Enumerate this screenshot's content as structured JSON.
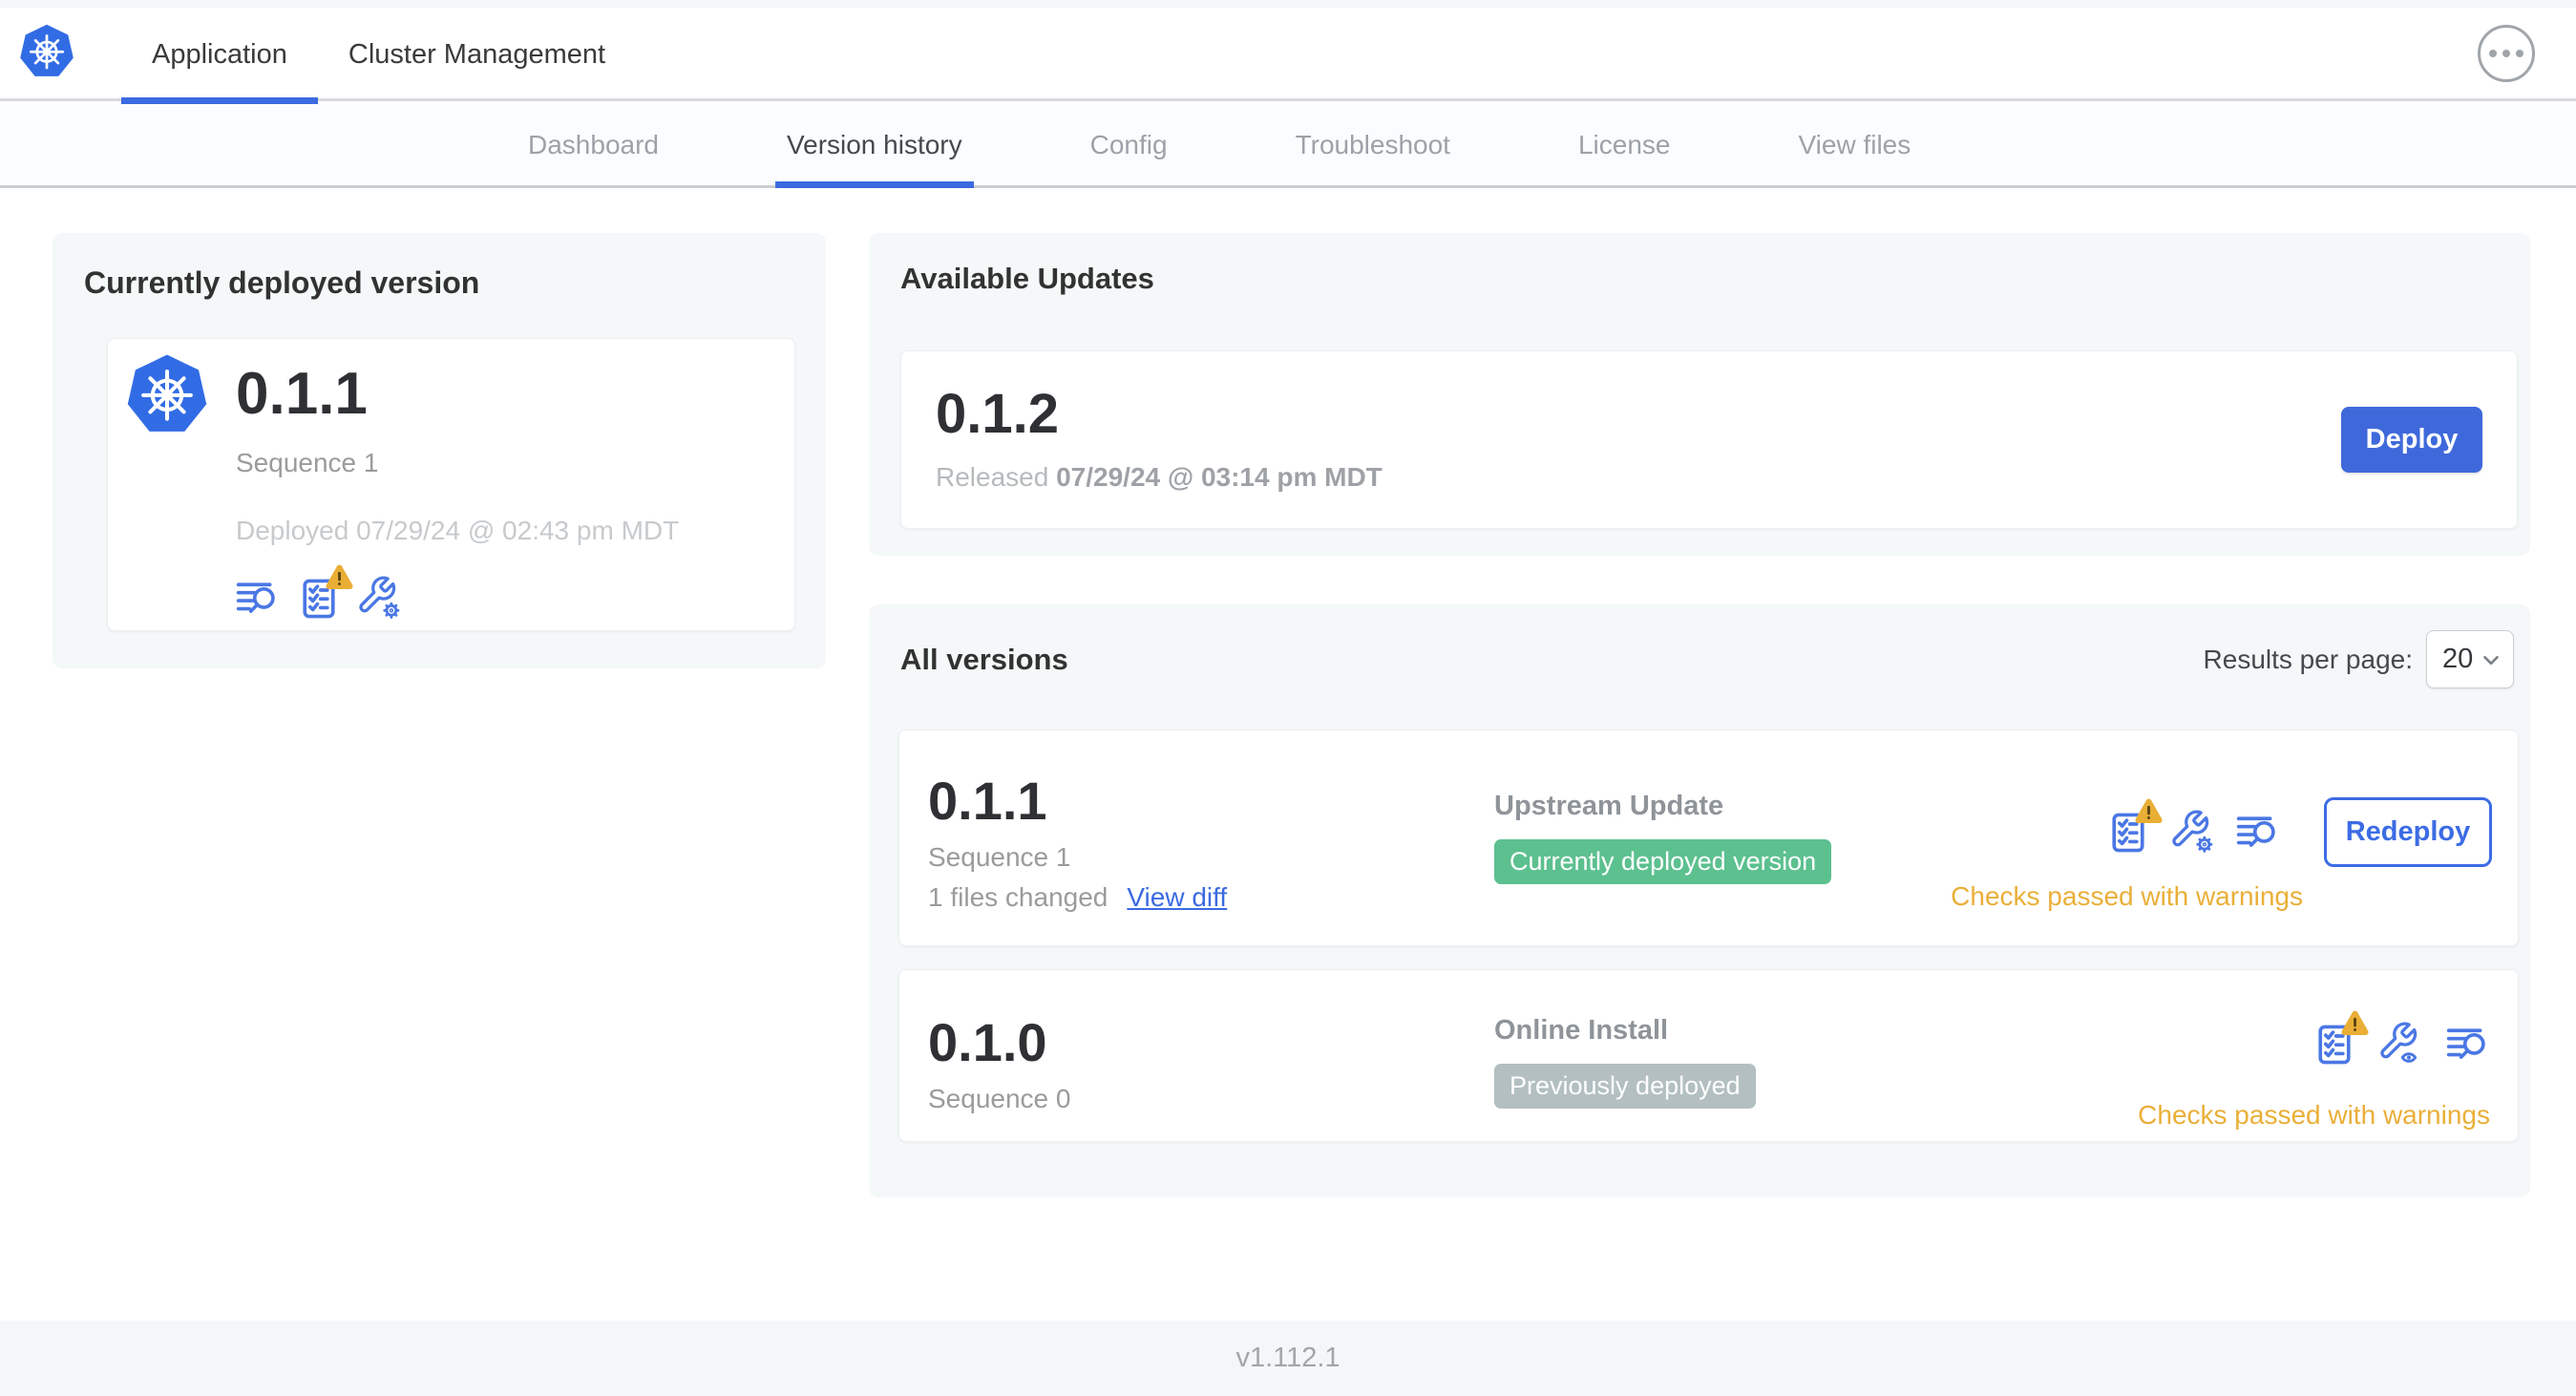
{
  "header": {
    "logo_icon": "kubernetes-logo",
    "tabs": [
      {
        "label": "Application",
        "active": true
      },
      {
        "label": "Cluster Management",
        "active": false
      }
    ],
    "more_icon": "ellipsis-more"
  },
  "nav": {
    "tabs": [
      {
        "label": "Dashboard",
        "active": false
      },
      {
        "label": "Version history",
        "active": true
      },
      {
        "label": "Config",
        "active": false
      },
      {
        "label": "Troubleshoot",
        "active": false
      },
      {
        "label": "License",
        "active": false
      },
      {
        "label": "View files",
        "active": false
      }
    ]
  },
  "current": {
    "title": "Currently deployed version",
    "version": "0.1.1",
    "sequence": "Sequence 1",
    "deployed": "Deployed 07/29/24 @ 02:43 pm MDT",
    "icons": [
      "deploy-logs",
      "preflight-checks-warning",
      "edit-config"
    ]
  },
  "updates": {
    "title": "Available Updates",
    "version": "0.1.2",
    "released_prefix": "Released",
    "released_date": "07/29/24 @ 03:14 pm MDT",
    "deploy_label": "Deploy"
  },
  "all_versions": {
    "title": "All versions",
    "results_label": "Results per page:",
    "results_value": "20",
    "rows": [
      {
        "version": "0.1.1",
        "sequence": "Sequence 1",
        "files_changed": "1 files changed",
        "view_diff": "View diff",
        "source": "Upstream Update",
        "badge": "Currently deployed version",
        "badge_type": "green",
        "icons": [
          "preflight-checks-warning",
          "edit-config",
          "deploy-logs"
        ],
        "action": "Redeploy",
        "status": "Checks passed with warnings"
      },
      {
        "version": "0.1.0",
        "sequence": "Sequence 0",
        "source": "Online Install",
        "badge": "Previously deployed",
        "badge_type": "gray",
        "icons": [
          "preflight-checks-warning",
          "view-config",
          "deploy-logs"
        ],
        "status": "Checks passed with warnings"
      }
    ]
  },
  "footer": {
    "version": "v1.112.1"
  },
  "colors": {
    "primary_blue": "#3F69DB",
    "icon_blue": "#4A77E4",
    "link_blue": "#3B6AE0",
    "k8s_blue": "#326CE5",
    "badge_green": "#5CC08F",
    "badge_gray": "#B3BFC1",
    "warning_amber": "#EAAF38",
    "card_bg": "#F5F8F9",
    "strip_bg": "#F5F6F8"
  }
}
